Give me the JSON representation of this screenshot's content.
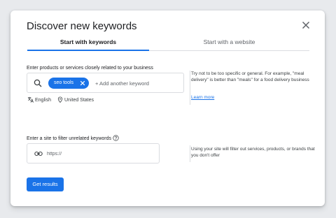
{
  "dialog": {
    "title": "Discover new keywords",
    "close_icon": "close-icon"
  },
  "tabs": [
    {
      "label": "Start with keywords",
      "active": true
    },
    {
      "label": "Start with a website",
      "active": false
    }
  ],
  "keywords": {
    "label": "Enter products or services closely related to your business",
    "search_icon": "search-icon",
    "chip_label": "seo tools",
    "placeholder": "+ Add another keyword",
    "language": "English",
    "location": "United States",
    "help_text": "Try not to be too specific or general. For example, \"meal delivery\" is better than \"meals\" for a food delivery business",
    "learn_more": "Learn more"
  },
  "site": {
    "label": "Enter a site to filter unrelated keywords",
    "help_icon": "help-circle-icon",
    "link_icon": "link-icon",
    "placeholder": "https://",
    "help_text": "Using your site will filter out services, products, or brands that you don't offer"
  },
  "actions": {
    "submit_label": "Get results"
  },
  "colors": {
    "accent": "#1a73e8",
    "backdrop": "#e8eaed"
  }
}
